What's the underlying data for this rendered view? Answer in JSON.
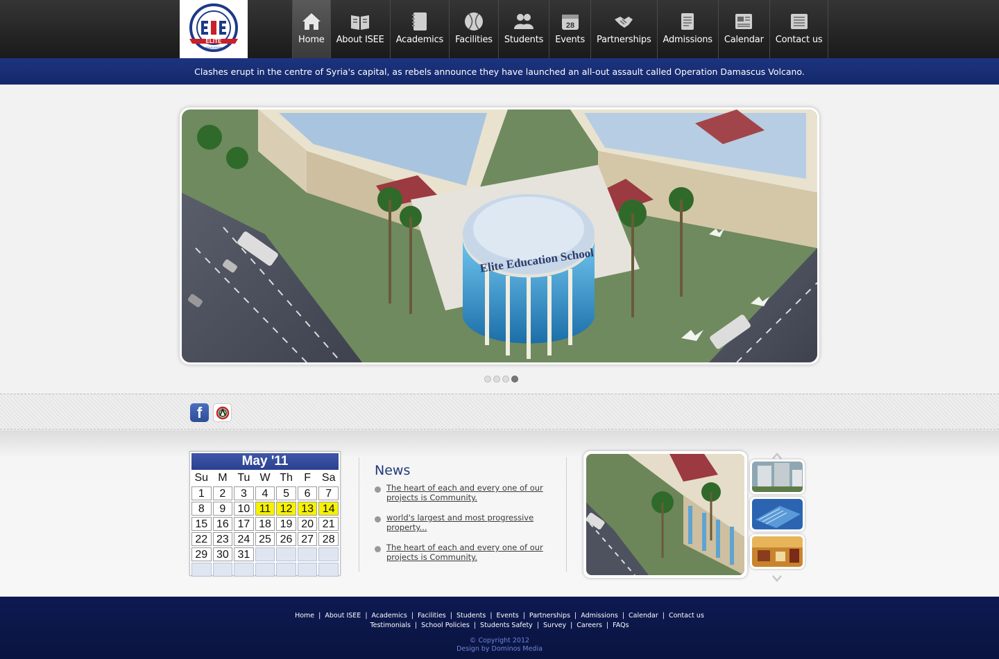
{
  "logo": {
    "ring_text": "THE INTERNATIONAL SCHOOL OF",
    "banner_text": "ELITE",
    "sub_text": "EDUCATION"
  },
  "nav": {
    "items": [
      {
        "label": "Home",
        "icon": "home-icon",
        "active": true
      },
      {
        "label": "About ISEE",
        "icon": "open-book-icon"
      },
      {
        "label": "Academics",
        "icon": "notebook-icon"
      },
      {
        "label": "Facilities",
        "icon": "tennis-ball-icon"
      },
      {
        "label": "Students",
        "icon": "people-icon"
      },
      {
        "label": "Events",
        "icon": "calendar-28-icon"
      },
      {
        "label": "Partnerships",
        "icon": "handshake-icon"
      },
      {
        "label": "Admissions",
        "icon": "document-icon"
      },
      {
        "label": "Calendar",
        "icon": "newspaper-icon"
      },
      {
        "label": "Contact us",
        "icon": "contact-card-icon"
      }
    ],
    "calendar_icon_day": "28"
  },
  "ticker": {
    "text": "Clashes erupt in the centre of Syria's capital, as rebels announce they have launched an all-out assault called Operation Damascus Volcano."
  },
  "hero": {
    "building_sign": "Elite Education School",
    "slide_count": 4,
    "active_slide": 4
  },
  "social": {
    "facebook_glyph": "f",
    "facebook_icon": "facebook-icon",
    "other_icon": "circular-logo-icon"
  },
  "calendar": {
    "title": "May '11",
    "weekdays": [
      "Su",
      "M",
      "Tu",
      "W",
      "Th",
      "F",
      "Sa"
    ],
    "days": [
      "1",
      "2",
      "3",
      "4",
      "5",
      "6",
      "7",
      "8",
      "9",
      "10",
      "11",
      "12",
      "13",
      "14",
      "15",
      "16",
      "17",
      "18",
      "19",
      "20",
      "21",
      "22",
      "23",
      "24",
      "25",
      "26",
      "27",
      "28",
      "29",
      "30",
      "31",
      "",
      "",
      "",
      "",
      "",
      "",
      "",
      "",
      "",
      "",
      ""
    ],
    "highlighted": [
      "11",
      "12",
      "13",
      "14"
    ]
  },
  "news": {
    "title": "News",
    "items": [
      "The heart of each and every one of our projects is Community.",
      "world's largest and most progressive property...",
      "The heart of each and every one of our projects is Community."
    ]
  },
  "gallery": {
    "thumbs": [
      "tower-thumbnail",
      "building-thumbnail",
      "interior-thumbnail"
    ],
    "up_icon": "chevron-up-icon",
    "down_icon": "chevron-down-icon"
  },
  "footer": {
    "row1": [
      "Home",
      "About ISEE",
      "Academics",
      "Facilities",
      "Students",
      "Events",
      "Partnerships",
      "Admissions",
      "Calendar",
      "Contact us"
    ],
    "row2": [
      "Testimonials",
      "School Policies",
      "Students Safety",
      "Survey",
      "Careers",
      "FAQs"
    ],
    "copyright": "© Copyright 2012",
    "design_credit": "Design by Dominos Media"
  },
  "colors": {
    "ticker_bg": "#1c3480",
    "footer_bg": "#0d1a52",
    "calendar_highlight": "#f7f200",
    "news_title": "#1f3a78"
  }
}
